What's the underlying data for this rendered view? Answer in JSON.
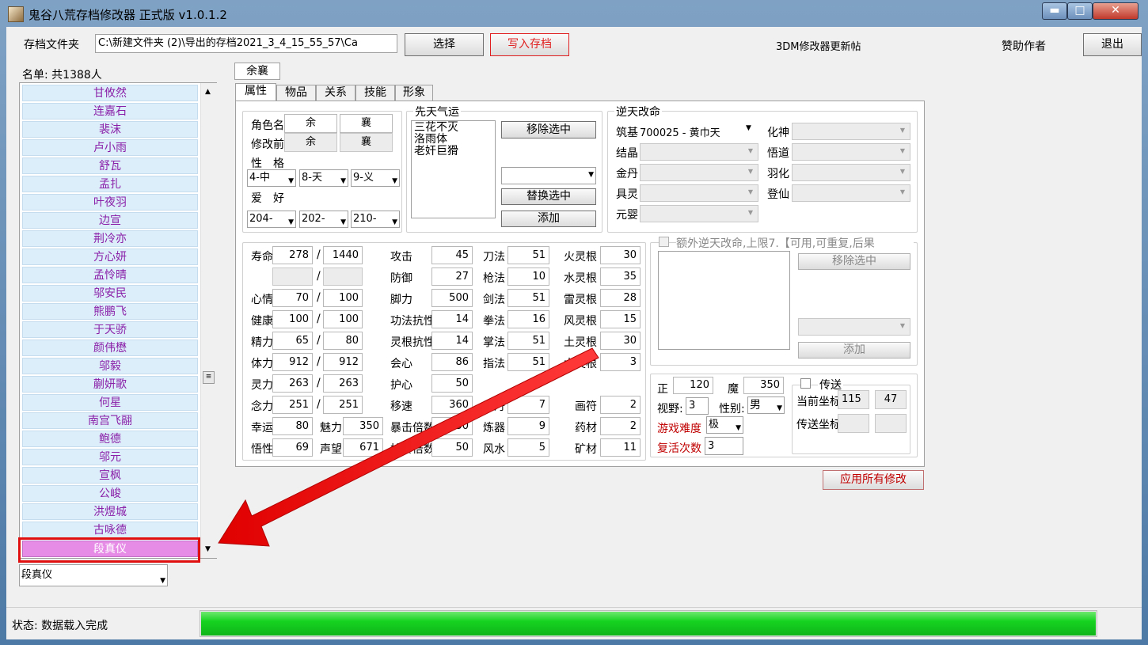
{
  "window": {
    "title": "鬼谷八荒存档修改器 正式版 v1.0.1.2",
    "min": "▬",
    "max": "□",
    "close": "✕"
  },
  "toolbar": {
    "folder_label": "存档文件夹",
    "folder_path": "C:\\新建文件夹 (2)\\导出的存档2021_3_4_15_55_57\\Ca",
    "select_button": "选择",
    "write_button": "写入存档",
    "link_3dm": "3DM修改器更新帖",
    "sponsor": "赞助作者",
    "exit_button": "退出"
  },
  "roster": {
    "header": "名单: 共1388人",
    "items": [
      "甘攸然",
      "连嘉石",
      "裴沫",
      "卢小雨",
      "舒瓦",
      "孟扎",
      "叶夜羽",
      "边宣",
      "荆冷亦",
      "方心妍",
      "孟怜晴",
      "邬安民",
      "熊鹏飞",
      "于天骄",
      "颜伟懋",
      "邬毅",
      "蒯妍歌",
      "何星",
      "南宫飞翮",
      "鲍德",
      "邬元",
      "宣枫",
      "公峻",
      "洪煜城",
      "古咏德"
    ],
    "selected": "段真仪",
    "search_value": "段真仪"
  },
  "character": {
    "name_tab": "余襄"
  },
  "tabs": [
    "属性",
    "物品",
    "关系",
    "技能",
    "形象"
  ],
  "attributes": {
    "role_name_label": "角色名",
    "before_label": "修改前",
    "surname": "余",
    "given": "襄",
    "surname_before": "余",
    "given_before": "襄",
    "personality_label": "性　格",
    "personality": [
      "4-中",
      "8-天",
      "9-义"
    ],
    "hobby_label": "爱　好",
    "hobby": [
      "204-",
      "202-",
      "210-"
    ]
  },
  "innate": {
    "title": "先天气运",
    "list": [
      "三花不灭",
      "洛雨体",
      "老奸巨猾"
    ],
    "remove": "移除选中",
    "replace": "替换选中",
    "add": "添加"
  },
  "destiny": {
    "title": "逆天改命",
    "rows_left": [
      {
        "label": "筑基",
        "value": "700025 - 黄巾天"
      },
      {
        "label": "结晶",
        "value": ""
      },
      {
        "label": "金丹",
        "value": ""
      },
      {
        "label": "具灵",
        "value": ""
      },
      {
        "label": "元婴",
        "value": ""
      }
    ],
    "rows_right": [
      {
        "label": "化神",
        "value": ""
      },
      {
        "label": "悟道",
        "value": ""
      },
      {
        "label": "羽化",
        "value": ""
      },
      {
        "label": "登仙",
        "value": ""
      }
    ]
  },
  "extra_destiny": {
    "title": "额外逆天改命,上限7.【可用,可重复,后果",
    "remove": "移除选中",
    "add": "添加"
  },
  "stats_col1": [
    {
      "label": "寿命",
      "cur": "278",
      "max": "1440"
    },
    {
      "label": "",
      "cur": "",
      "max": ""
    },
    {
      "label": "心情",
      "cur": "70",
      "max": "100"
    },
    {
      "label": "健康",
      "cur": "100",
      "max": "100"
    },
    {
      "label": "精力",
      "cur": "65",
      "max": "80"
    },
    {
      "label": "体力",
      "cur": "912",
      "max": "912"
    },
    {
      "label": "灵力",
      "cur": "263",
      "max": "263"
    },
    {
      "label": "念力",
      "cur": "251",
      "max": "251"
    }
  ],
  "stats_luck": {
    "label": "幸运",
    "value": "80",
    "charm_label": "魅力",
    "charm": "350"
  },
  "stats_wu": {
    "label": "悟性",
    "value": "69",
    "fame_label": "声望",
    "fame": "671"
  },
  "stats_col2": [
    {
      "label": "攻击",
      "value": "45"
    },
    {
      "label": "防御",
      "value": "27"
    },
    {
      "label": "脚力",
      "value": "500"
    },
    {
      "label": "功法抗性",
      "value": "14"
    },
    {
      "label": "灵根抗性",
      "value": "14"
    },
    {
      "label": "会心",
      "value": "86"
    },
    {
      "label": "护心",
      "value": "50"
    },
    {
      "label": "移速",
      "value": "360"
    },
    {
      "label": "暴击倍数",
      "value": "250"
    },
    {
      "label": "护暴倍数",
      "value": "50"
    }
  ],
  "stats_col3": [
    {
      "label": "刀法",
      "value": "51"
    },
    {
      "label": "枪法",
      "value": "10"
    },
    {
      "label": "剑法",
      "value": "51"
    },
    {
      "label": "拳法",
      "value": "16"
    },
    {
      "label": "掌法",
      "value": "51"
    },
    {
      "label": "指法",
      "value": "51"
    },
    {
      "label": "炼丹",
      "value": "7"
    },
    {
      "label": "炼器",
      "value": "9"
    },
    {
      "label": "风水",
      "value": "5"
    }
  ],
  "stats_col4": [
    {
      "label": "火灵根",
      "value": "30"
    },
    {
      "label": "水灵根",
      "value": "35"
    },
    {
      "label": "雷灵根",
      "value": "28"
    },
    {
      "label": "风灵根",
      "value": "15"
    },
    {
      "label": "土灵根",
      "value": "30"
    },
    {
      "label": "木灵根",
      "value": "3"
    },
    {
      "label": "画符",
      "value": "2"
    },
    {
      "label": "药材",
      "value": "2"
    },
    {
      "label": "矿材",
      "value": "11"
    }
  ],
  "misc": {
    "zheng_label": "正",
    "zheng": "120",
    "mo_label": "魔",
    "mo": "350",
    "vision_label": "视野:",
    "vision": "3",
    "gender_label": "性别:",
    "gender": "男",
    "difficulty_label": "游戏难度",
    "difficulty": "极",
    "revive_label": "复活次数",
    "revive": "3",
    "teleport_label": "传送",
    "cur_coord_label": "当前坐标",
    "cur_x": "115",
    "cur_y": "47",
    "tp_coord_label": "传送坐标"
  },
  "apply_button": "应用所有修改",
  "status": {
    "text": "状态: 数据载入完成",
    "progress": 1.0
  },
  "colors": {
    "progress": "#16d320",
    "list_text": "#8a1fa8",
    "selected_bg": "#e68be6",
    "highlight": "#e01010"
  }
}
